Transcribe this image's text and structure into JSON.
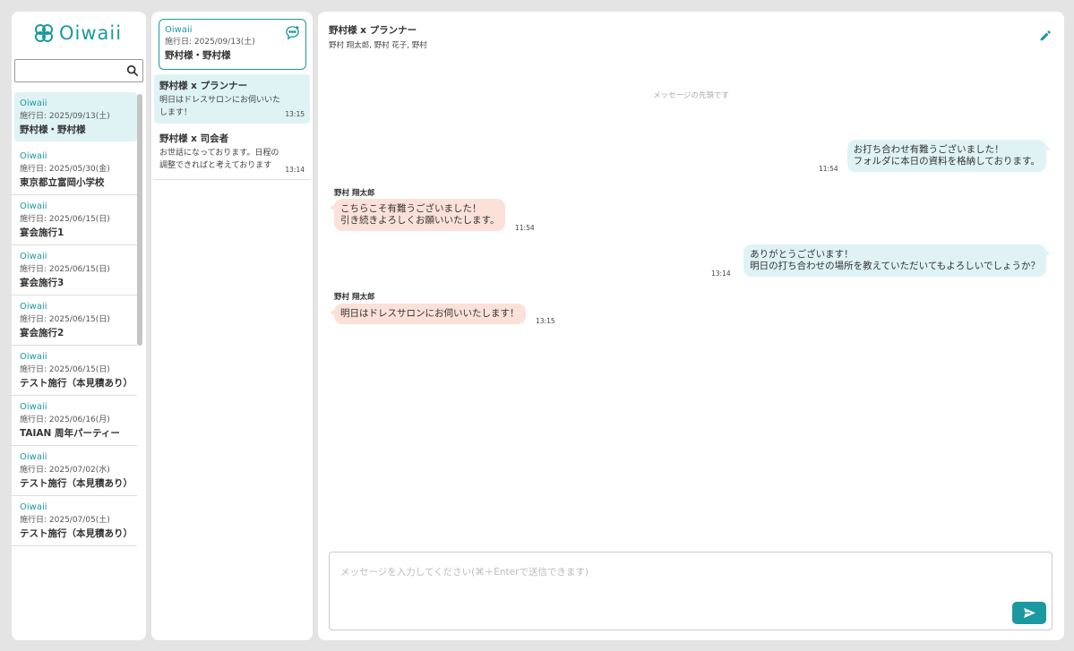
{
  "brand": {
    "logo_text": "Oiwaii",
    "accent_color": "#1a9aa0"
  },
  "search": {
    "placeholder": "",
    "value": ""
  },
  "projects": [
    {
      "org": "Oiwaii",
      "date": "施行日: 2025/09/13(土)",
      "name": "野村様・野村様",
      "active": true
    },
    {
      "org": "Oiwaii",
      "date": "施行日: 2025/05/30(金)",
      "name": "東京都立富岡小学校"
    },
    {
      "org": "Oiwaii",
      "date": "施行日: 2025/06/15(日)",
      "name": "宴会施行1"
    },
    {
      "org": "Oiwaii",
      "date": "施行日: 2025/06/15(日)",
      "name": "宴会施行3"
    },
    {
      "org": "Oiwaii",
      "date": "施行日: 2025/06/15(日)",
      "name": "宴会施行2"
    },
    {
      "org": "Oiwaii",
      "date": "施行日: 2025/06/15(日)",
      "name": "テスト施行（本見積あり）"
    },
    {
      "org": "Oiwaii",
      "date": "施行日: 2025/06/16(月)",
      "name": "TAIAN 周年パーティー"
    },
    {
      "org": "Oiwaii",
      "date": "施行日: 2025/07/02(水)",
      "name": "テスト施行（本見積あり）"
    },
    {
      "org": "Oiwaii",
      "date": "施行日: 2025/07/05(土)",
      "name": "テスト施行（本見積あり）"
    }
  ],
  "group_card": {
    "org": "Oiwaii",
    "date": "施行日: 2025/09/13(土)",
    "name": "野村様・野村様"
  },
  "rooms": [
    {
      "title": "野村様 x プランナー",
      "preview": "明日はドレスサロンにお伺いいたします！",
      "time": "13:15",
      "active": true
    },
    {
      "title": "野村様 x 司会者",
      "preview": "お世話になっております。日程の調整できればと考えております",
      "time": "13:14"
    }
  ],
  "chat": {
    "title": "野村様 x プランナー",
    "members": "野村 翔太郎, 野村 花子, 野村",
    "start_label": "メッセージの先頭です",
    "messages": [
      {
        "dir": "out",
        "lines": [
          "お打ち合わせ有難うございました！",
          "フォルダに本日の資料を格納しております。"
        ],
        "time": "11:54"
      },
      {
        "dir": "in",
        "sender": "野村 翔太郎",
        "lines": [
          "こちらこそ有難うございました！",
          "引き続きよろしくお願いいたします。"
        ],
        "time": "11:54"
      },
      {
        "dir": "out",
        "lines": [
          "ありがとうございます！",
          "明日の打ち合わせの場所を教えていただいてもよろしいでしょうか？"
        ],
        "time": "13:14"
      },
      {
        "dir": "in",
        "sender": "野村 翔太郎",
        "lines": [
          "明日はドレスサロンにお伺いいたします！"
        ],
        "time": "13:15"
      }
    ],
    "composer_placeholder": "メッセージを入力してください(⌘＋Enterで送信できます)"
  }
}
